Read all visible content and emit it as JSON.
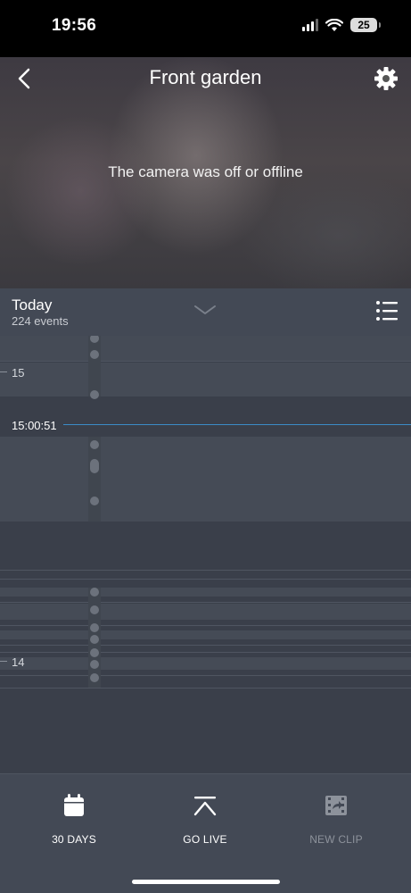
{
  "status_bar": {
    "time": "19:56",
    "battery": "25"
  },
  "header": {
    "title": "Front garden"
  },
  "camera": {
    "message": "The camera was off or offline"
  },
  "timeline_header": {
    "day": "Today",
    "event_count": "224 events"
  },
  "timeline": {
    "hour_15": "15",
    "current_time": "15:00:51",
    "hour_14": "14"
  },
  "bottom_bar": {
    "days_label": "30 DAYS",
    "live_label": "GO LIVE",
    "clip_label": "NEW CLIP"
  },
  "colors": {
    "accent_line": "#3b8bc7",
    "background": "#3a3f4a",
    "panel": "#434955"
  },
  "icons": [
    "back-chevron",
    "gear",
    "chevron-down",
    "list",
    "calendar",
    "go-live-arrow",
    "clip"
  ]
}
